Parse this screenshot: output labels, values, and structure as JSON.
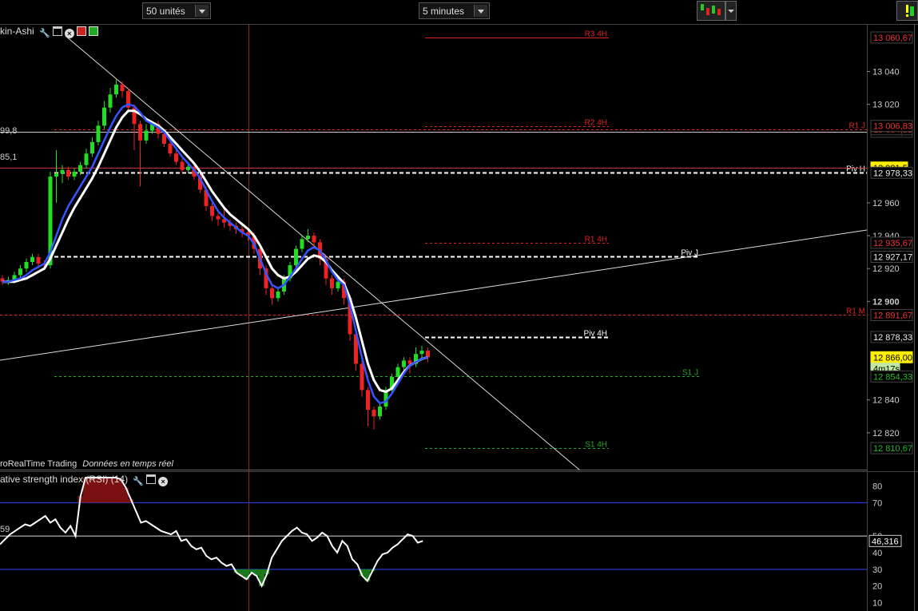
{
  "toolbar": {
    "units_value": "50 unités",
    "timeframe_value": "5 minutes"
  },
  "price_pane": {
    "title": "kin-Ashi",
    "footer_source": "roRealTime Trading",
    "footer_status": "Données en temps réel",
    "left_values": [
      "99,8",
      "85,1"
    ]
  },
  "rsi_pane": {
    "title": "ative strength index (RSI) (14)",
    "left_value": "59"
  },
  "colors": {
    "bull": "#22dd22",
    "bear": "#ee2222",
    "ma_fast": "#3355ff",
    "ma_slow": "#ffffff",
    "resistance": "#dd2222",
    "support": "#22aa22",
    "rsi_line": "#ffffff",
    "rsi_bounds": "#3344ff",
    "last_price_bg": "#ffee00"
  },
  "chart_data": [
    {
      "type": "candlestick",
      "ylim": [
        12800,
        13066
      ],
      "yticks": [
        13040,
        13020,
        12960,
        12940,
        12920,
        12900,
        12840,
        12820
      ],
      "y_axis_labels": [
        "13 040",
        "13 020",
        "12 960",
        "12 940",
        "12 920",
        "12 900",
        "12 840",
        "12 820"
      ],
      "price_labels": [
        {
          "text": "13 060,67",
          "value": 13060.67,
          "kind": "resistance"
        },
        {
          "text": "13 003,33",
          "value": 13003.33,
          "kind": "resistance"
        },
        {
          "text": "13 004,83",
          "value": 13004.83,
          "kind": "resistance"
        },
        {
          "text": "13 006,83",
          "value": 13006.83,
          "kind": "resistance"
        },
        {
          "text": "12 981,5",
          "value": 12981.5,
          "kind": "last_highlight"
        },
        {
          "text": "12 978,33",
          "value": 12978.33,
          "kind": "pivot"
        },
        {
          "text": "12 935,67",
          "value": 12935.67,
          "kind": "resistance"
        },
        {
          "text": "12 927,17",
          "value": 12927.17,
          "kind": "pivot"
        },
        {
          "text": "12 891,67",
          "value": 12891.67,
          "kind": "resistance"
        },
        {
          "text": "12 878,33",
          "value": 12878.33,
          "kind": "pivot"
        },
        {
          "text": "12 866,00",
          "value": 12866.0,
          "kind": "last_price"
        },
        {
          "text": "4m17s",
          "value": 12859,
          "kind": "timer"
        },
        {
          "text": "12 854,33",
          "value": 12854.33,
          "kind": "support"
        },
        {
          "text": "12 810,67",
          "value": 12810.67,
          "kind": "support"
        }
      ],
      "levels": [
        {
          "label": "R3 4H",
          "value": 13060.67,
          "color": "resistance",
          "style": "solid"
        },
        {
          "label": "R2 4H",
          "value": 13006.83,
          "color": "resistance",
          "style": "dashed"
        },
        {
          "label": "R1 J",
          "value": 13004.83,
          "color": "resistance",
          "style": "dashed"
        },
        {
          "label": "",
          "value": 13003.33,
          "color": "resistance",
          "style": "dashed"
        },
        {
          "label": "Piv H",
          "value": 12978.33,
          "color": "pivot",
          "style": "dashed"
        },
        {
          "label": "R1 4H",
          "value": 12935.67,
          "color": "resistance",
          "style": "dashed"
        },
        {
          "label": "Piv J",
          "value": 12927.17,
          "color": "pivot",
          "style": "dashed"
        },
        {
          "label": "R1 M",
          "value": 12891.67,
          "color": "resistance",
          "style": "dashed"
        },
        {
          "label": "Piv 4H",
          "value": 12878.33,
          "color": "pivot",
          "style": "dashed"
        },
        {
          "label": "S1 J",
          "value": 12854.33,
          "color": "support",
          "style": "dashed"
        },
        {
          "label": "S1 4H",
          "value": 12810.67,
          "color": "support",
          "style": "dashed"
        }
      ],
      "candles": [
        {
          "o": 12914,
          "c": 12912,
          "h": 12916,
          "l": 12910
        },
        {
          "o": 12912,
          "c": 12913,
          "h": 12915,
          "l": 12910
        },
        {
          "o": 12913,
          "c": 12916,
          "h": 12918,
          "l": 12911
        },
        {
          "o": 12916,
          "c": 12920,
          "h": 12922,
          "l": 12914
        },
        {
          "o": 12920,
          "c": 12924,
          "h": 12926,
          "l": 12918
        },
        {
          "o": 12924,
          "c": 12927,
          "h": 12929,
          "l": 12922
        },
        {
          "o": 12927,
          "c": 12923,
          "h": 12929,
          "l": 12920
        },
        {
          "o": 12923,
          "c": 12922,
          "h": 12925,
          "l": 12919
        },
        {
          "o": 12922,
          "c": 12976,
          "h": 12979,
          "l": 12920
        },
        {
          "o": 12976,
          "c": 12978,
          "h": 12992,
          "l": 12960
        },
        {
          "o": 12978,
          "c": 12980,
          "h": 12983,
          "l": 12972
        },
        {
          "o": 12980,
          "c": 12976,
          "h": 12982,
          "l": 12974
        },
        {
          "o": 12976,
          "c": 12979,
          "h": 12981,
          "l": 12974
        },
        {
          "o": 12979,
          "c": 12983,
          "h": 12985,
          "l": 12977
        },
        {
          "o": 12983,
          "c": 12990,
          "h": 12993,
          "l": 12981
        },
        {
          "o": 12990,
          "c": 12997,
          "h": 13000,
          "l": 12988
        },
        {
          "o": 12997,
          "c": 13007,
          "h": 13010,
          "l": 12995
        },
        {
          "o": 13007,
          "c": 13018,
          "h": 13022,
          "l": 13005
        },
        {
          "o": 13018,
          "c": 13026,
          "h": 13030,
          "l": 13015
        },
        {
          "o": 13026,
          "c": 13032,
          "h": 13035,
          "l": 13024
        },
        {
          "o": 13032,
          "c": 13028,
          "h": 13034,
          "l": 13024
        },
        {
          "o": 13028,
          "c": 13018,
          "h": 13030,
          "l": 13016
        },
        {
          "o": 13018,
          "c": 13008,
          "h": 13020,
          "l": 12992
        },
        {
          "o": 13008,
          "c": 12998,
          "h": 13010,
          "l": 12970
        },
        {
          "o": 12998,
          "c": 13004,
          "h": 13008,
          "l": 12996
        },
        {
          "o": 13004,
          "c": 13008,
          "h": 13010,
          "l": 13002
        },
        {
          "o": 13008,
          "c": 13002,
          "h": 13010,
          "l": 12999
        },
        {
          "o": 13002,
          "c": 12996,
          "h": 13004,
          "l": 12994
        },
        {
          "o": 12996,
          "c": 12990,
          "h": 12998,
          "l": 12988
        },
        {
          "o": 12990,
          "c": 12985,
          "h": 12992,
          "l": 12983
        },
        {
          "o": 12985,
          "c": 12980,
          "h": 12987,
          "l": 12978
        },
        {
          "o": 12980,
          "c": 12982,
          "h": 12984,
          "l": 12978
        },
        {
          "o": 12982,
          "c": 12976,
          "h": 12984,
          "l": 12974
        },
        {
          "o": 12976,
          "c": 12968,
          "h": 12978,
          "l": 12966
        },
        {
          "o": 12968,
          "c": 12958,
          "h": 12970,
          "l": 12955
        },
        {
          "o": 12958,
          "c": 12952,
          "h": 12960,
          "l": 12949
        },
        {
          "o": 12952,
          "c": 12950,
          "h": 12954,
          "l": 12946
        },
        {
          "o": 12950,
          "c": 12948,
          "h": 12956,
          "l": 12945
        },
        {
          "o": 12948,
          "c": 12946,
          "h": 12950,
          "l": 12943
        },
        {
          "o": 12946,
          "c": 12944,
          "h": 12948,
          "l": 12941
        },
        {
          "o": 12944,
          "c": 12942,
          "h": 12946,
          "l": 12939
        },
        {
          "o": 12942,
          "c": 12940,
          "h": 12944,
          "l": 12937
        },
        {
          "o": 12940,
          "c": 12932,
          "h": 12942,
          "l": 12929
        },
        {
          "o": 12932,
          "c": 12920,
          "h": 12934,
          "l": 12916
        },
        {
          "o": 12920,
          "c": 12908,
          "h": 12922,
          "l": 12904
        },
        {
          "o": 12908,
          "c": 12902,
          "h": 12910,
          "l": 12898
        },
        {
          "o": 12902,
          "c": 12906,
          "h": 12908,
          "l": 12900
        },
        {
          "o": 12906,
          "c": 12914,
          "h": 12916,
          "l": 12904
        },
        {
          "o": 12914,
          "c": 12922,
          "h": 12924,
          "l": 12912
        },
        {
          "o": 12922,
          "c": 12932,
          "h": 12934,
          "l": 12920
        },
        {
          "o": 12932,
          "c": 12938,
          "h": 12940,
          "l": 12930
        },
        {
          "o": 12938,
          "c": 12940,
          "h": 12944,
          "l": 12936
        },
        {
          "o": 12940,
          "c": 12936,
          "h": 12942,
          "l": 12932
        },
        {
          "o": 12936,
          "c": 12926,
          "h": 12938,
          "l": 12922
        },
        {
          "o": 12926,
          "c": 12914,
          "h": 12928,
          "l": 12910
        },
        {
          "o": 12914,
          "c": 12908,
          "h": 12916,
          "l": 12904
        },
        {
          "o": 12908,
          "c": 12912,
          "h": 12914,
          "l": 12906
        },
        {
          "o": 12912,
          "c": 12902,
          "h": 12914,
          "l": 12898
        },
        {
          "o": 12902,
          "c": 12880,
          "h": 12904,
          "l": 12876
        },
        {
          "o": 12880,
          "c": 12862,
          "h": 12882,
          "l": 12858
        },
        {
          "o": 12862,
          "c": 12846,
          "h": 12864,
          "l": 12842
        },
        {
          "o": 12846,
          "c": 12834,
          "h": 12848,
          "l": 12824
        },
        {
          "o": 12834,
          "c": 12830,
          "h": 12836,
          "l": 12822
        },
        {
          "o": 12830,
          "c": 12836,
          "h": 12838,
          "l": 12828
        },
        {
          "o": 12836,
          "c": 12846,
          "h": 12848,
          "l": 12834
        },
        {
          "o": 12846,
          "c": 12854,
          "h": 12856,
          "l": 12844
        },
        {
          "o": 12854,
          "c": 12860,
          "h": 12862,
          "l": 12852
        },
        {
          "o": 12860,
          "c": 12864,
          "h": 12866,
          "l": 12857
        },
        {
          "o": 12864,
          "c": 12862,
          "h": 12866,
          "l": 12856
        },
        {
          "o": 12862,
          "c": 12868,
          "h": 12872,
          "l": 12860
        },
        {
          "o": 12868,
          "c": 12870,
          "h": 12873,
          "l": 12864
        },
        {
          "o": 12870,
          "c": 12866,
          "h": 12872,
          "l": 12863
        }
      ],
      "ma_fast_values": [
        12912,
        12912,
        12913,
        12914,
        12916,
        12919,
        12921,
        12923,
        12930,
        12940,
        12950,
        12958,
        12964,
        12970,
        12976,
        12982,
        12990,
        12998,
        13006,
        13013,
        13018,
        13020,
        13019,
        13015,
        13010,
        13008,
        13006,
        13003,
        12998,
        12993,
        12988,
        12984,
        12980,
        12975,
        12968,
        12961,
        12955,
        12951,
        12948,
        12945,
        12942,
        12940,
        12935,
        12926,
        12917,
        12910,
        12908,
        12910,
        12915,
        12920,
        12926,
        12931,
        12933,
        12931,
        12925,
        12918,
        12913,
        12910,
        12898,
        12882,
        12866,
        12852,
        12842,
        12838,
        12839,
        12844,
        12850,
        12856,
        12861,
        12863,
        12865,
        12866
      ],
      "ma_slow_values": [
        12912,
        12912,
        12912,
        12913,
        12914,
        12916,
        12918,
        12920,
        12926,
        12934,
        12942,
        12950,
        12957,
        12963,
        12969,
        12975,
        12982,
        12990,
        12998,
        13006,
        13012,
        13016,
        13016,
        13014,
        13011,
        13009,
        13007,
        13004,
        13000,
        12996,
        12992,
        12988,
        12984,
        12979,
        12973,
        12967,
        12962,
        12957,
        12953,
        12950,
        12947,
        12944,
        12940,
        12934,
        12927,
        12920,
        12916,
        12914,
        12915,
        12918,
        12922,
        12926,
        12928,
        12927,
        12924,
        12919,
        12915,
        12911,
        12902,
        12890,
        12876,
        12862,
        12852,
        12846,
        12845,
        12847,
        12852,
        12857,
        12861,
        12863,
        12865,
        12866
      ]
    },
    {
      "type": "line",
      "name": "RSI (14)",
      "ylim": [
        5,
        85
      ],
      "yticks": [
        80,
        70,
        50,
        40,
        30,
        20,
        10
      ],
      "y_axis_labels": [
        "80",
        "70",
        "50",
        "40",
        "30",
        "20",
        "10"
      ],
      "bounds": [
        70,
        30
      ],
      "midline": 50,
      "last_value_label": "46,316",
      "values": [
        45,
        48,
        51,
        53,
        55,
        57,
        56,
        58,
        60,
        62,
        58,
        60,
        55,
        52,
        56,
        50,
        74,
        86,
        88,
        92,
        91,
        89,
        93,
        87,
        84,
        79,
        72,
        65,
        58,
        59,
        57,
        55,
        53,
        52,
        51,
        53,
        47,
        48,
        44,
        42,
        43,
        38,
        36,
        37,
        34,
        32,
        33,
        28,
        26,
        24,
        28,
        26,
        20,
        27,
        37,
        42,
        47,
        50,
        53,
        55,
        52,
        51,
        47,
        49,
        52,
        50,
        44,
        40,
        47,
        44,
        36,
        33,
        26,
        23,
        29,
        35,
        39,
        40,
        43,
        45,
        48,
        51,
        50,
        46,
        47
      ]
    }
  ]
}
